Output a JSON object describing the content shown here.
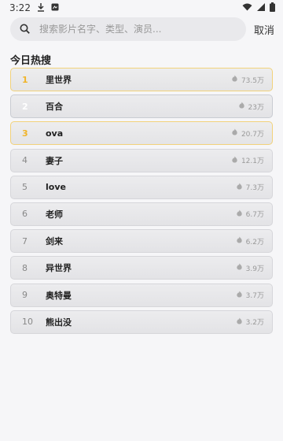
{
  "status": {
    "time": "3:22"
  },
  "search": {
    "placeholder": "搜索影片名字、类型、演员...",
    "cancel_label": "取消"
  },
  "hot": {
    "title": "今日热搜",
    "items": [
      {
        "rank": "1",
        "title": "里世界",
        "count": "73.5万"
      },
      {
        "rank": "2",
        "title": "百合",
        "count": "23万"
      },
      {
        "rank": "3",
        "title": "ova",
        "count": "20.7万"
      },
      {
        "rank": "4",
        "title": "妻子",
        "count": "12.1万"
      },
      {
        "rank": "5",
        "title": "love",
        "count": "7.3万"
      },
      {
        "rank": "6",
        "title": "老师",
        "count": "6.7万"
      },
      {
        "rank": "7",
        "title": "剑来",
        "count": "6.2万"
      },
      {
        "rank": "8",
        "title": "异世界",
        "count": "3.9万"
      },
      {
        "rank": "9",
        "title": "奥特曼",
        "count": "3.7万"
      },
      {
        "rank": "10",
        "title": "熊出没",
        "count": "3.2万"
      }
    ]
  },
  "colors": {
    "gold_rank": "#f0b429",
    "gold_border": "#f2d27a",
    "background": "#f6f6f8"
  }
}
